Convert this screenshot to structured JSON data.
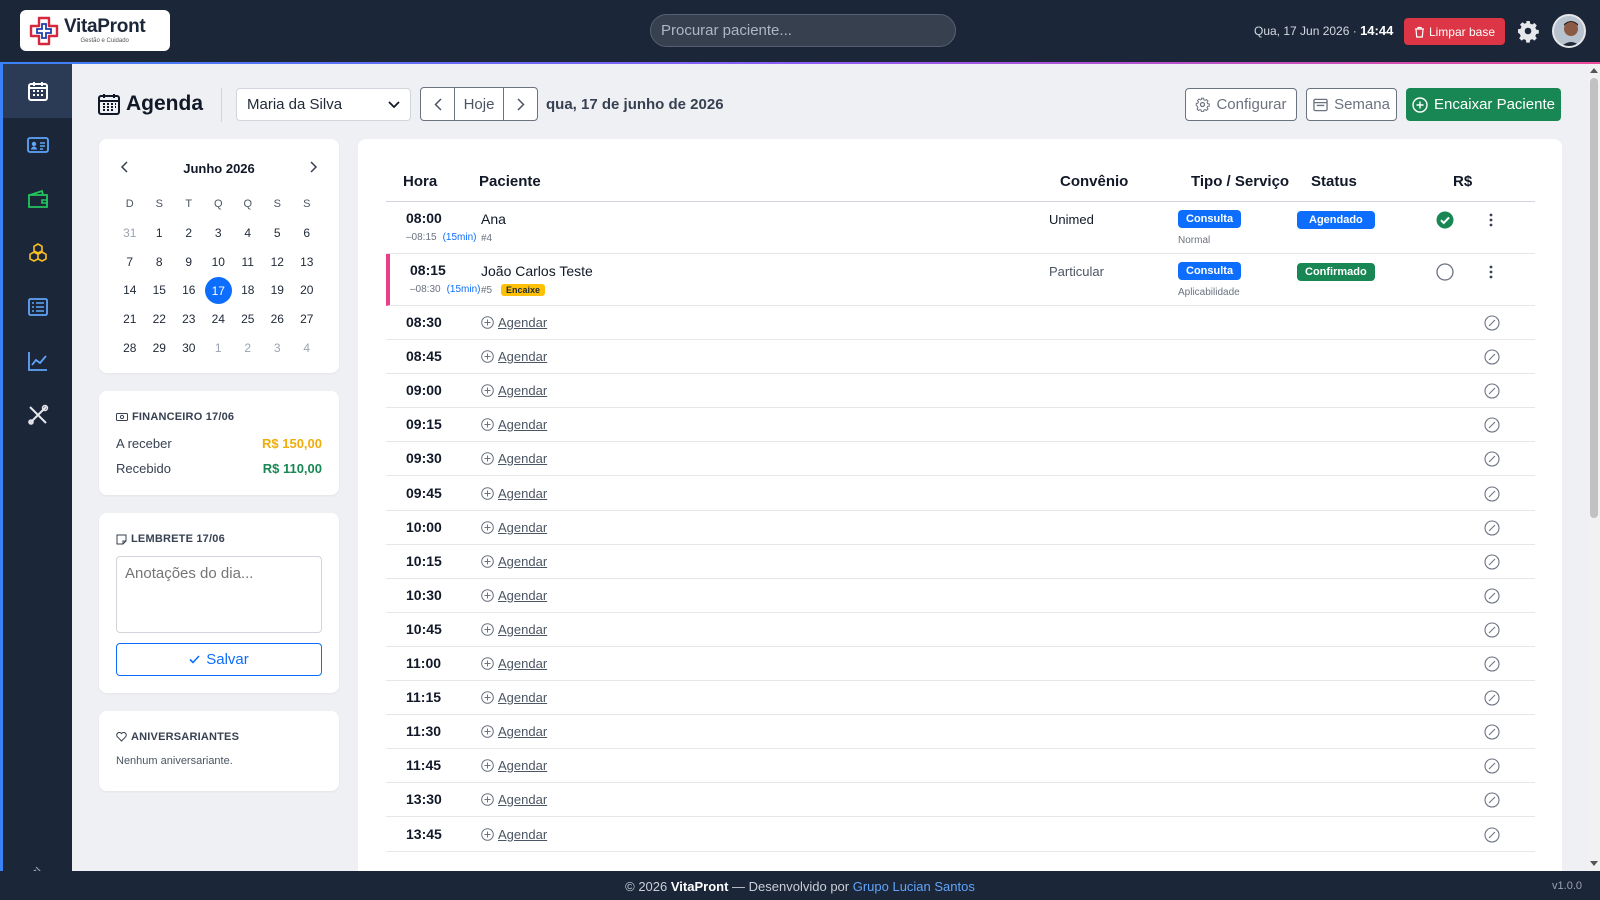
{
  "app": {
    "brand": "VitaPront",
    "tagline": "Gestão e Cuidado"
  },
  "topbar": {
    "search_placeholder": "Procurar paciente...",
    "date_text": "Qua, 17 Jun 2026 · ",
    "time_text": "14:44",
    "clear_label": "Limpar base",
    "settings_icon": "gear-icon",
    "avatar_icon": "user-avatar"
  },
  "sidebar": {
    "items": [
      {
        "icon": "calendar-icon",
        "active": true
      },
      {
        "icon": "id-card-icon",
        "active": false
      },
      {
        "icon": "wallet-icon",
        "active": false
      },
      {
        "icon": "boxes-icon",
        "active": false
      },
      {
        "icon": "list-icon",
        "active": false
      },
      {
        "icon": "chart-line-icon",
        "active": false
      },
      {
        "icon": "tools-icon",
        "active": false
      }
    ],
    "pin_icon": "pin-icon"
  },
  "header": {
    "title": "Agenda",
    "doctor": "Maria da Silva",
    "today_label": "Hoje",
    "current_date": "qua, 17 de junho de 2026",
    "configure_label": "Configurar",
    "week_label": "Semana",
    "encaixe_label": "Encaixar Paciente"
  },
  "calendar": {
    "month_label": "Junho 2026",
    "weekdays": [
      "D",
      "S",
      "T",
      "Q",
      "Q",
      "S",
      "S"
    ],
    "weeks": [
      [
        {
          "d": "31",
          "m": true
        },
        {
          "d": "1"
        },
        {
          "d": "2"
        },
        {
          "d": "3"
        },
        {
          "d": "4"
        },
        {
          "d": "5"
        },
        {
          "d": "6"
        }
      ],
      [
        {
          "d": "7"
        },
        {
          "d": "8"
        },
        {
          "d": "9"
        },
        {
          "d": "10"
        },
        {
          "d": "11"
        },
        {
          "d": "12"
        },
        {
          "d": "13"
        }
      ],
      [
        {
          "d": "14"
        },
        {
          "d": "15"
        },
        {
          "d": "16"
        },
        {
          "d": "17",
          "sel": true
        },
        {
          "d": "18"
        },
        {
          "d": "19"
        },
        {
          "d": "20"
        }
      ],
      [
        {
          "d": "21"
        },
        {
          "d": "22"
        },
        {
          "d": "23"
        },
        {
          "d": "24"
        },
        {
          "d": "25"
        },
        {
          "d": "26"
        },
        {
          "d": "27"
        }
      ],
      [
        {
          "d": "28"
        },
        {
          "d": "29"
        },
        {
          "d": "30"
        },
        {
          "d": "1",
          "m": true
        },
        {
          "d": "2",
          "m": true
        },
        {
          "d": "3",
          "m": true
        },
        {
          "d": "4",
          "m": true
        }
      ]
    ]
  },
  "financeiro": {
    "title": "FINANCEIRO 17/06",
    "receivable_label": "A receber",
    "receivable_value": "R$ 150,00",
    "received_label": "Recebido",
    "received_value": "R$ 110,00"
  },
  "lembrete": {
    "title": "LEMBRETE 17/06",
    "placeholder": "Anotações do dia...",
    "save_label": "Salvar"
  },
  "aniversariantes": {
    "title": "ANIVERSARIANTES",
    "empty_text": "Nenhum aniversariante."
  },
  "table": {
    "columns": {
      "hora": "Hora",
      "paciente": "Paciente",
      "convenio": "Convênio",
      "tipo": "Tipo / Serviço",
      "status": "Status",
      "pagamento": "R$"
    },
    "appointments": [
      {
        "time": "08:00",
        "range": "–08:15",
        "duration": "(15min)",
        "patient": "Ana",
        "patient_id": "#4",
        "encaixe": "",
        "convenio": "Unimed",
        "service": "Consulta",
        "service_sub": "Normal",
        "status": "Agendado",
        "status_color": "#0d6efd",
        "paid": true
      },
      {
        "time": "08:15",
        "range": "–08:30",
        "duration": "(15min)",
        "patient": "João Carlos Teste",
        "patient_id": "#5",
        "encaixe": "Encaixe",
        "convenio": "Particular",
        "service": "Consulta",
        "service_sub": "Aplicabilidade",
        "status": "Confirmado",
        "status_color": "#198754",
        "paid": false
      }
    ],
    "free_slot_label": "Agendar",
    "free_slots": [
      "08:30",
      "08:45",
      "09:00",
      "09:15",
      "09:30",
      "09:45",
      "10:00",
      "10:15",
      "10:30",
      "10:45",
      "11:00",
      "11:15",
      "11:30",
      "11:45",
      "13:30",
      "13:45"
    ]
  },
  "footer": {
    "copyright": "© 2026 ",
    "brand": "VitaPront",
    "dev_text": " — Desenvolvido por ",
    "dev_link": "Grupo Lucian Santos",
    "version": "v1.0.0"
  },
  "colors": {
    "navy": "#1b2638",
    "primary": "#0d6efd",
    "success": "#198754",
    "danger": "#dc3545",
    "warning": "#ffc107",
    "accent_pink": "#e83e8c"
  }
}
